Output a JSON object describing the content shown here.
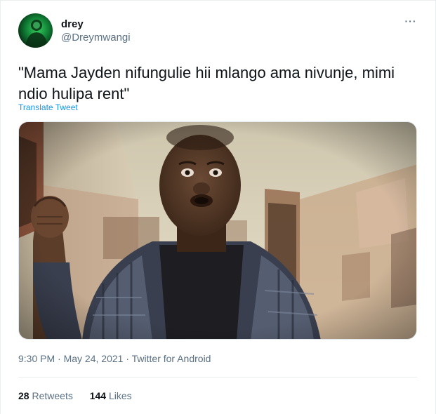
{
  "author": {
    "name": "drey",
    "handle": "@Dreymwangi"
  },
  "more_icon": "more-dots-icon",
  "tweet": {
    "text": "\"Mama Jayden nifungulie hii mlango ama nivunje, mimi ndio hulipa rent\"",
    "translate_label": "Translate Tweet"
  },
  "meta": {
    "time": "9:30 PM",
    "separator": " · ",
    "date": "May 24, 2021",
    "client": "Twitter for Android"
  },
  "stats": {
    "retweets_count": "28",
    "retweets_label": "Retweets",
    "likes_count": "144",
    "likes_label": "Likes"
  },
  "colors": {
    "text_primary": "#0f1419",
    "text_secondary": "#5b7083",
    "link": "#1b95e0",
    "border": "#ebeef0"
  }
}
